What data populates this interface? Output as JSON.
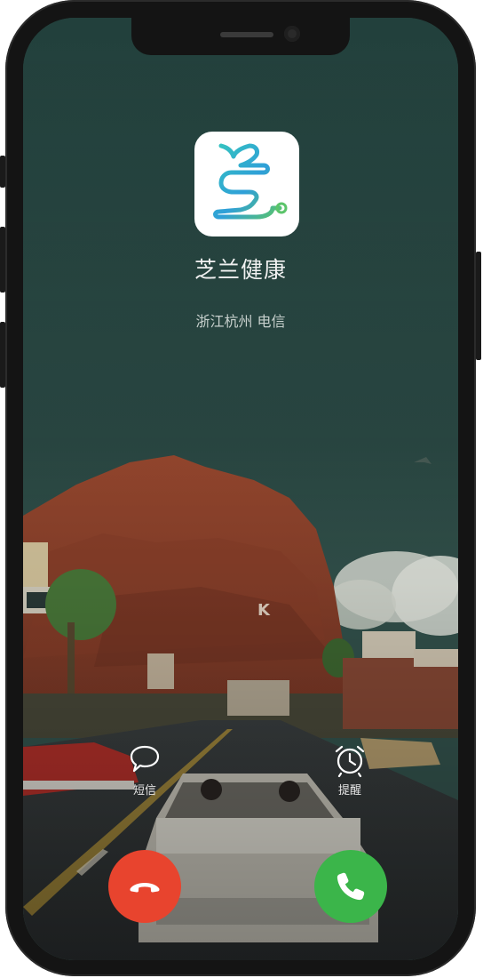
{
  "caller": {
    "name": "芝兰健康",
    "location": "浙江杭州 电信"
  },
  "actions": {
    "message": "短信",
    "remind": "提醒"
  },
  "icons": {
    "app": "zhilan-app-logo-icon",
    "message": "speech-bubble-icon",
    "remind": "alarm-clock-icon",
    "decline": "phone-hangup-icon",
    "accept": "phone-icon"
  },
  "colors": {
    "decline": "#e8442e",
    "accept": "#3bb54a",
    "sky": "#25433f"
  }
}
